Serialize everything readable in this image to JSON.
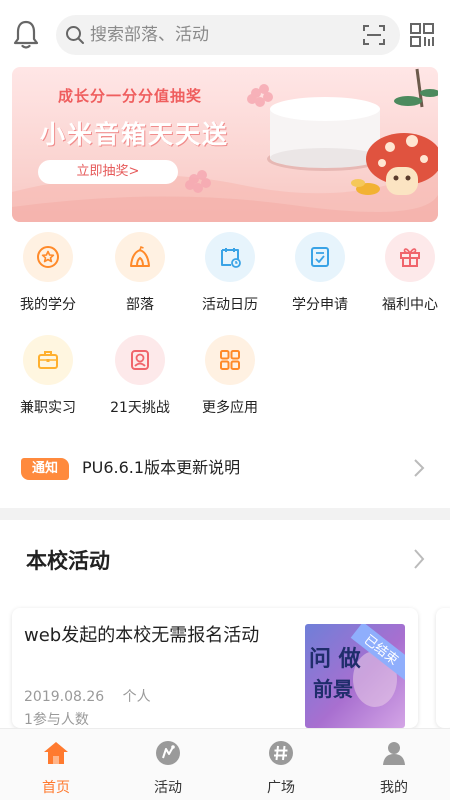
{
  "header": {
    "search_placeholder": "搜索部落、活动"
  },
  "banner": {
    "subtitle": "成长分一分分值抽奖",
    "title": "小米音箱天天送",
    "cta": "立即抽奖>",
    "slides": 5,
    "active_slide": 1
  },
  "shortcuts": [
    {
      "label": "我的学分",
      "icon": "star-badge-icon",
      "bg": "#fff1e2",
      "color": "#ff8a2a"
    },
    {
      "label": "部落",
      "icon": "tent-icon",
      "bg": "#fff1e2",
      "color": "#ff8a2a"
    },
    {
      "label": "活动日历",
      "icon": "calendar-icon",
      "bg": "#e7f4fc",
      "color": "#3aa3e6"
    },
    {
      "label": "学分申请",
      "icon": "checklist-icon",
      "bg": "#e7f4fc",
      "color": "#3aa3e6"
    },
    {
      "label": "福利中心",
      "icon": "gift-icon",
      "bg": "#fde9ea",
      "color": "#f0646c"
    },
    {
      "label": "兼职实习",
      "icon": "briefcase-icon",
      "bg": "#fff6e0",
      "color": "#ffb02e"
    },
    {
      "label": "21天挑战",
      "icon": "challenge-icon",
      "bg": "#fde9ea",
      "color": "#f0646c"
    },
    {
      "label": "更多应用",
      "icon": "apps-grid-icon",
      "bg": "#fff1e2",
      "color": "#ff8a2a"
    }
  ],
  "notice": {
    "tag": "通知",
    "text": "PU6.6.1版本更新说明"
  },
  "section": {
    "title": "本校活动"
  },
  "activity": {
    "title": "web发起的本校无需报名活动",
    "date": "2019.08.26",
    "organizer": "个人",
    "participants": "1参与人数",
    "status": "已结束",
    "thumb_text_1": "问 做",
    "thumb_text_2": "前景"
  },
  "tabs": [
    {
      "label": "首页",
      "icon": "home-icon",
      "active": true
    },
    {
      "label": "活动",
      "icon": "activity-icon",
      "active": false
    },
    {
      "label": "广场",
      "icon": "hashtag-icon",
      "active": false
    },
    {
      "label": "我的",
      "icon": "user-icon",
      "active": false
    }
  ],
  "colors": {
    "accent": "#ff7a2f",
    "notice_tag": "#ff8a3d",
    "banner_text": "#ef5e5e",
    "gray_text": "#9a9a9a"
  }
}
